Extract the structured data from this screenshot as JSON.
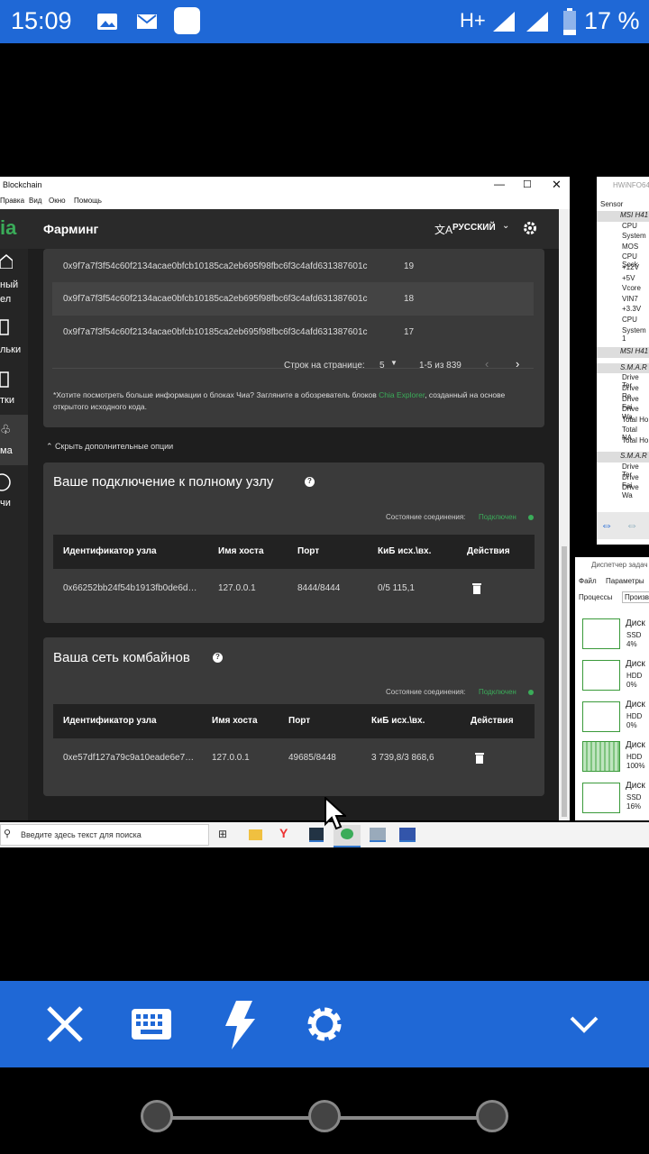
{
  "status_bar": {
    "time": "15:09",
    "network": "H+",
    "battery": "17 %"
  },
  "window": {
    "title": "Blockchain",
    "menu": [
      "Правка",
      "Вид",
      "Окно",
      "Помощь"
    ],
    "logo": "ia"
  },
  "appbar": {
    "title": "Фарминг",
    "language": "РУССКИЙ"
  },
  "sidebar": {
    "items": [
      "ный",
      "ел",
      "льки",
      "тки",
      "ма",
      "чи"
    ]
  },
  "blocks": {
    "rows": [
      {
        "hash": "0x9f7a7f3f54c60f2134acae0bfcb10185ca2eb695f98fbc6f3c4afd631387601c",
        "height": "19"
      },
      {
        "hash": "0x9f7a7f3f54c60f2134acae0bfcb10185ca2eb695f98fbc6f3c4afd631387601c",
        "height": "18"
      },
      {
        "hash": "0x9f7a7f3f54c60f2134acae0bfcb10185ca2eb695f98fbc6f3c4afd631387601c",
        "height": "17"
      }
    ],
    "rows_per_page_label": "Строк на странице:",
    "rows_per_page": "5",
    "range": "1-5 из 839",
    "note_prefix": "*Хотите посмотреть больше информации о блоках Чиа? Загляните в обозреватель блоков ",
    "note_link": "Chia Explorer",
    "note_suffix": ", созданный на основе открытого исходного кода."
  },
  "toggle_options": "Скрыть дополнительные опции",
  "full_node": {
    "title": "Ваше подключение к полному узлу",
    "status_label": "Состояние соединения:",
    "status_value": "Подключен",
    "headers": [
      "Идентификатор узла",
      "Имя хоста",
      "Порт",
      "КиБ исх.\\вх.",
      "Действия"
    ],
    "row": {
      "id": "0x66252bb24f54b1913fb0de6d…",
      "host": "127.0.0.1",
      "port": "8444/8444",
      "kib": "0/5 115,1"
    }
  },
  "harvesters": {
    "title": "Ваша сеть комбайнов",
    "status_label": "Состояние соединения:",
    "status_value": "Подключен",
    "headers": [
      "Идентификатор узла",
      "Имя хоста",
      "Порт",
      "КиБ исх.\\вх.",
      "Действия"
    ],
    "row": {
      "id": "0xe57df127a79c9a10eade6e7…",
      "host": "127.0.0.1",
      "port": "49685/8448",
      "kib": "3 739,8/3 868,6"
    }
  },
  "taskbar": {
    "search_placeholder": "Введите здесь текст для поиска"
  },
  "hwinfo": {
    "title": "HWiNFO64",
    "header": "Sensor",
    "items": [
      "MSI H41",
      "CPU",
      "System",
      "MOS",
      "CPU Sock",
      "+12V",
      "+5V",
      "Vcore",
      "VIN7",
      "+3.3V",
      "CPU",
      "System 1",
      "MSI H41",
      "S.M.A.R",
      "Drive Ter",
      "Drive Re",
      "Drive Fai",
      "Drive Wa",
      "Total Ho",
      "Total NA",
      "Total Ho",
      "S.M.A.R",
      "Drive Ter",
      "Drive Fai",
      "Drive Wa"
    ]
  },
  "taskmgr": {
    "title": "Диспетчер задач",
    "menu": [
      "Файл",
      "Параметры"
    ],
    "tabs": [
      "Процессы",
      "Произв"
    ],
    "disks": [
      {
        "name": "Диск",
        "type": "SSD",
        "pct": "4%"
      },
      {
        "name": "Диск",
        "type": "HDD",
        "pct": "0%"
      },
      {
        "name": "Диск",
        "type": "HDD",
        "pct": "0%"
      },
      {
        "name": "Диск",
        "type": "HDD",
        "pct": "100%"
      },
      {
        "name": "Диск",
        "type": "SSD",
        "pct": "16%"
      }
    ]
  },
  "colors": {
    "status_blue": "#1f68d6",
    "chia_green": "#3aac59",
    "dark_bg": "#1e1e1e",
    "card_bg": "#3a3a3a"
  }
}
